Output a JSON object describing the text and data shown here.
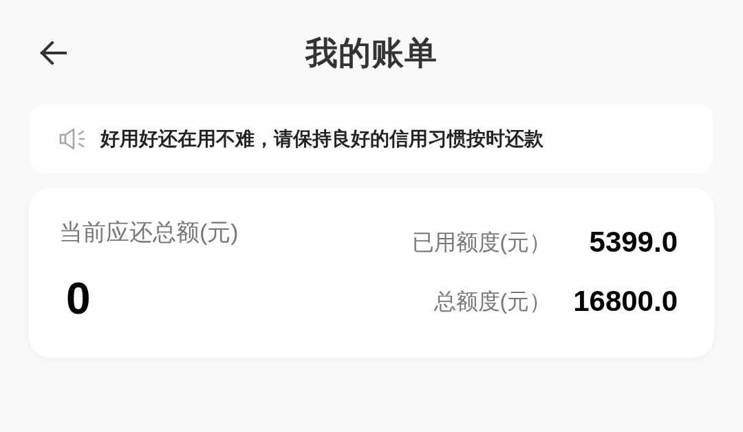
{
  "header": {
    "title": "我的账单"
  },
  "notice": {
    "text": "好用好还在用不难，请保持良好的信用习惯按时还款"
  },
  "summary": {
    "due_label": "当前应还总额(元)",
    "due_amount": "0",
    "stats": [
      {
        "label": "已用额度(元）",
        "value": "5399.0"
      },
      {
        "label": "总额度(元）",
        "value": "16800.0"
      }
    ]
  }
}
